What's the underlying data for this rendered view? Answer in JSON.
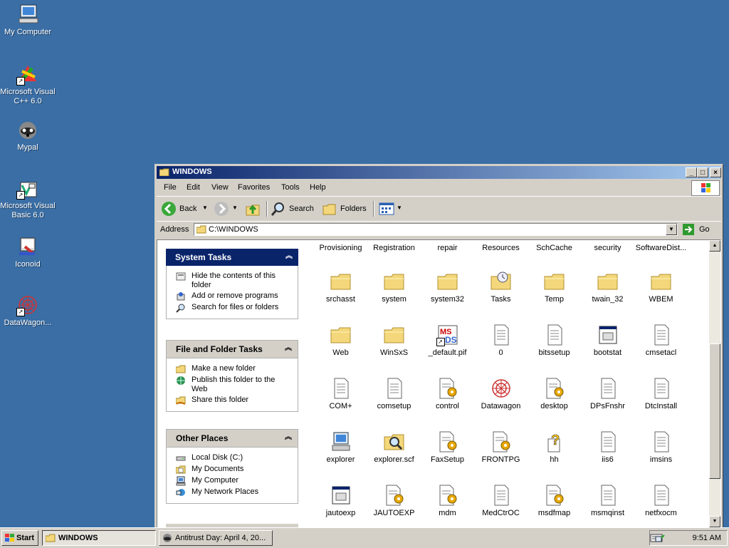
{
  "desktop": {
    "icons": [
      {
        "label": "My Computer",
        "icon": "my-computer-icon"
      },
      {
        "label": "Microsoft Visual C++ 6.0",
        "icon": "visual-cpp-icon"
      },
      {
        "label": "Mypal",
        "icon": "mypal-icon"
      },
      {
        "label": "Microsoft Visual Basic 6.0",
        "icon": "visual-basic-icon"
      },
      {
        "label": "Iconoid",
        "icon": "iconoid-icon"
      },
      {
        "label": "DataWagon...",
        "icon": "datawagon-icon"
      }
    ]
  },
  "window": {
    "title": "WINDOWS",
    "menu": [
      "File",
      "Edit",
      "View",
      "Favorites",
      "Tools",
      "Help"
    ],
    "toolbar": {
      "back": "Back",
      "search": "Search",
      "folders": "Folders"
    },
    "address": {
      "label": "Address",
      "value": "C:\\WINDOWS",
      "go": "Go"
    }
  },
  "tasks": {
    "system": {
      "title": "System Tasks",
      "items": [
        "Hide the contents of this folder",
        "Add or remove programs",
        "Search for files or folders"
      ]
    },
    "file_folder": {
      "title": "File and Folder Tasks",
      "items": [
        "Make a new folder",
        "Publish this folder to the Web",
        "Share this folder"
      ]
    },
    "other_places": {
      "title": "Other Places",
      "items": [
        "Local Disk (C:)",
        "My Documents",
        "My Computer",
        "My Network Places"
      ]
    }
  },
  "files": {
    "top_row": [
      "Provisioning",
      "Registration",
      "repair",
      "Resources",
      "SchCache",
      "security",
      "SoftwareDist..."
    ],
    "rows": [
      [
        "srchasst",
        "system",
        "system32",
        "Tasks",
        "Temp",
        "twain_32",
        "WBEM"
      ],
      [
        "Web",
        "WinSxS",
        "_default.pif",
        "0",
        "bitssetup",
        "bootstat",
        "cmsetacl"
      ],
      [
        "COM+",
        "comsetup",
        "control",
        "Datawagon",
        "desktop",
        "DPsFnshr",
        "DtcInstall"
      ],
      [
        "explorer",
        "explorer.scf",
        "FaxSetup",
        "FRONTPG",
        "hh",
        "iis6",
        "imsins"
      ],
      [
        "jautoexp",
        "JAUTOEXP",
        "mdm",
        "MedCtrOC",
        "msdfmap",
        "msmqinst",
        "netfxocm"
      ]
    ]
  },
  "taskbar": {
    "start": "Start",
    "tasks": [
      "WINDOWS",
      "Antitrust Day: April 4, 20..."
    ],
    "clock": "9:51 AM"
  },
  "colors": {
    "desktop": "#3a6ea5",
    "titlebar": "#0a246a",
    "folder": "#f3d77a"
  }
}
